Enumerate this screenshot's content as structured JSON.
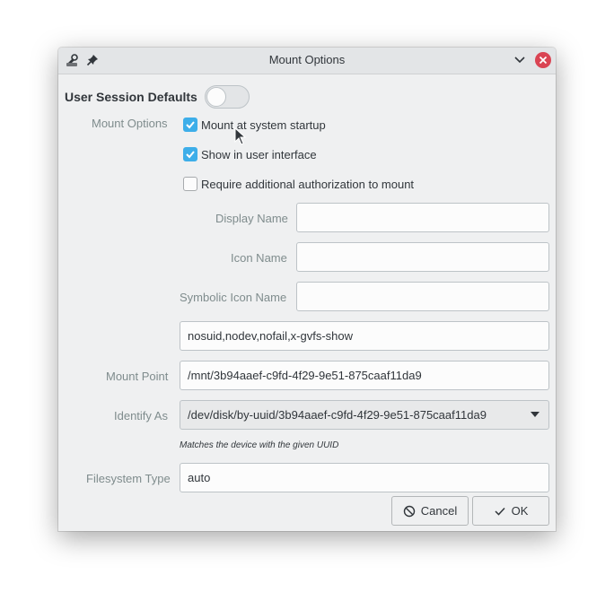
{
  "window": {
    "title": "Mount Options"
  },
  "user_session_defaults": {
    "label": "User Session Defaults",
    "enabled": false
  },
  "mount_options": {
    "section_label": "Mount Options",
    "mount_at_startup": {
      "label": "Mount at system startup",
      "checked": true
    },
    "show_in_ui": {
      "label": "Show in user interface",
      "checked": true
    },
    "require_auth": {
      "label": "Require additional authorization to mount",
      "checked": false
    }
  },
  "fields": {
    "display_name": {
      "label": "Display Name",
      "value": ""
    },
    "icon_name": {
      "label": "Icon Name",
      "value": ""
    },
    "symbolic_icon_name": {
      "label": "Symbolic Icon Name",
      "value": ""
    },
    "options": {
      "value": "nosuid,nodev,nofail,x-gvfs-show"
    },
    "mount_point": {
      "label": "Mount Point",
      "value": "/mnt/3b94aaef-c9fd-4f29-9e51-875caaf11da9"
    },
    "identify_as": {
      "label": "Identify As",
      "value": "/dev/disk/by-uuid/3b94aaef-c9fd-4f29-9e51-875caaf11da9",
      "hint": "Matches the device with the given UUID"
    },
    "filesystem_type": {
      "label": "Filesystem Type",
      "value": "auto"
    }
  },
  "buttons": {
    "cancel": "Cancel",
    "ok": "OK"
  },
  "colors": {
    "accent": "#3daee9",
    "close": "#da4453"
  }
}
